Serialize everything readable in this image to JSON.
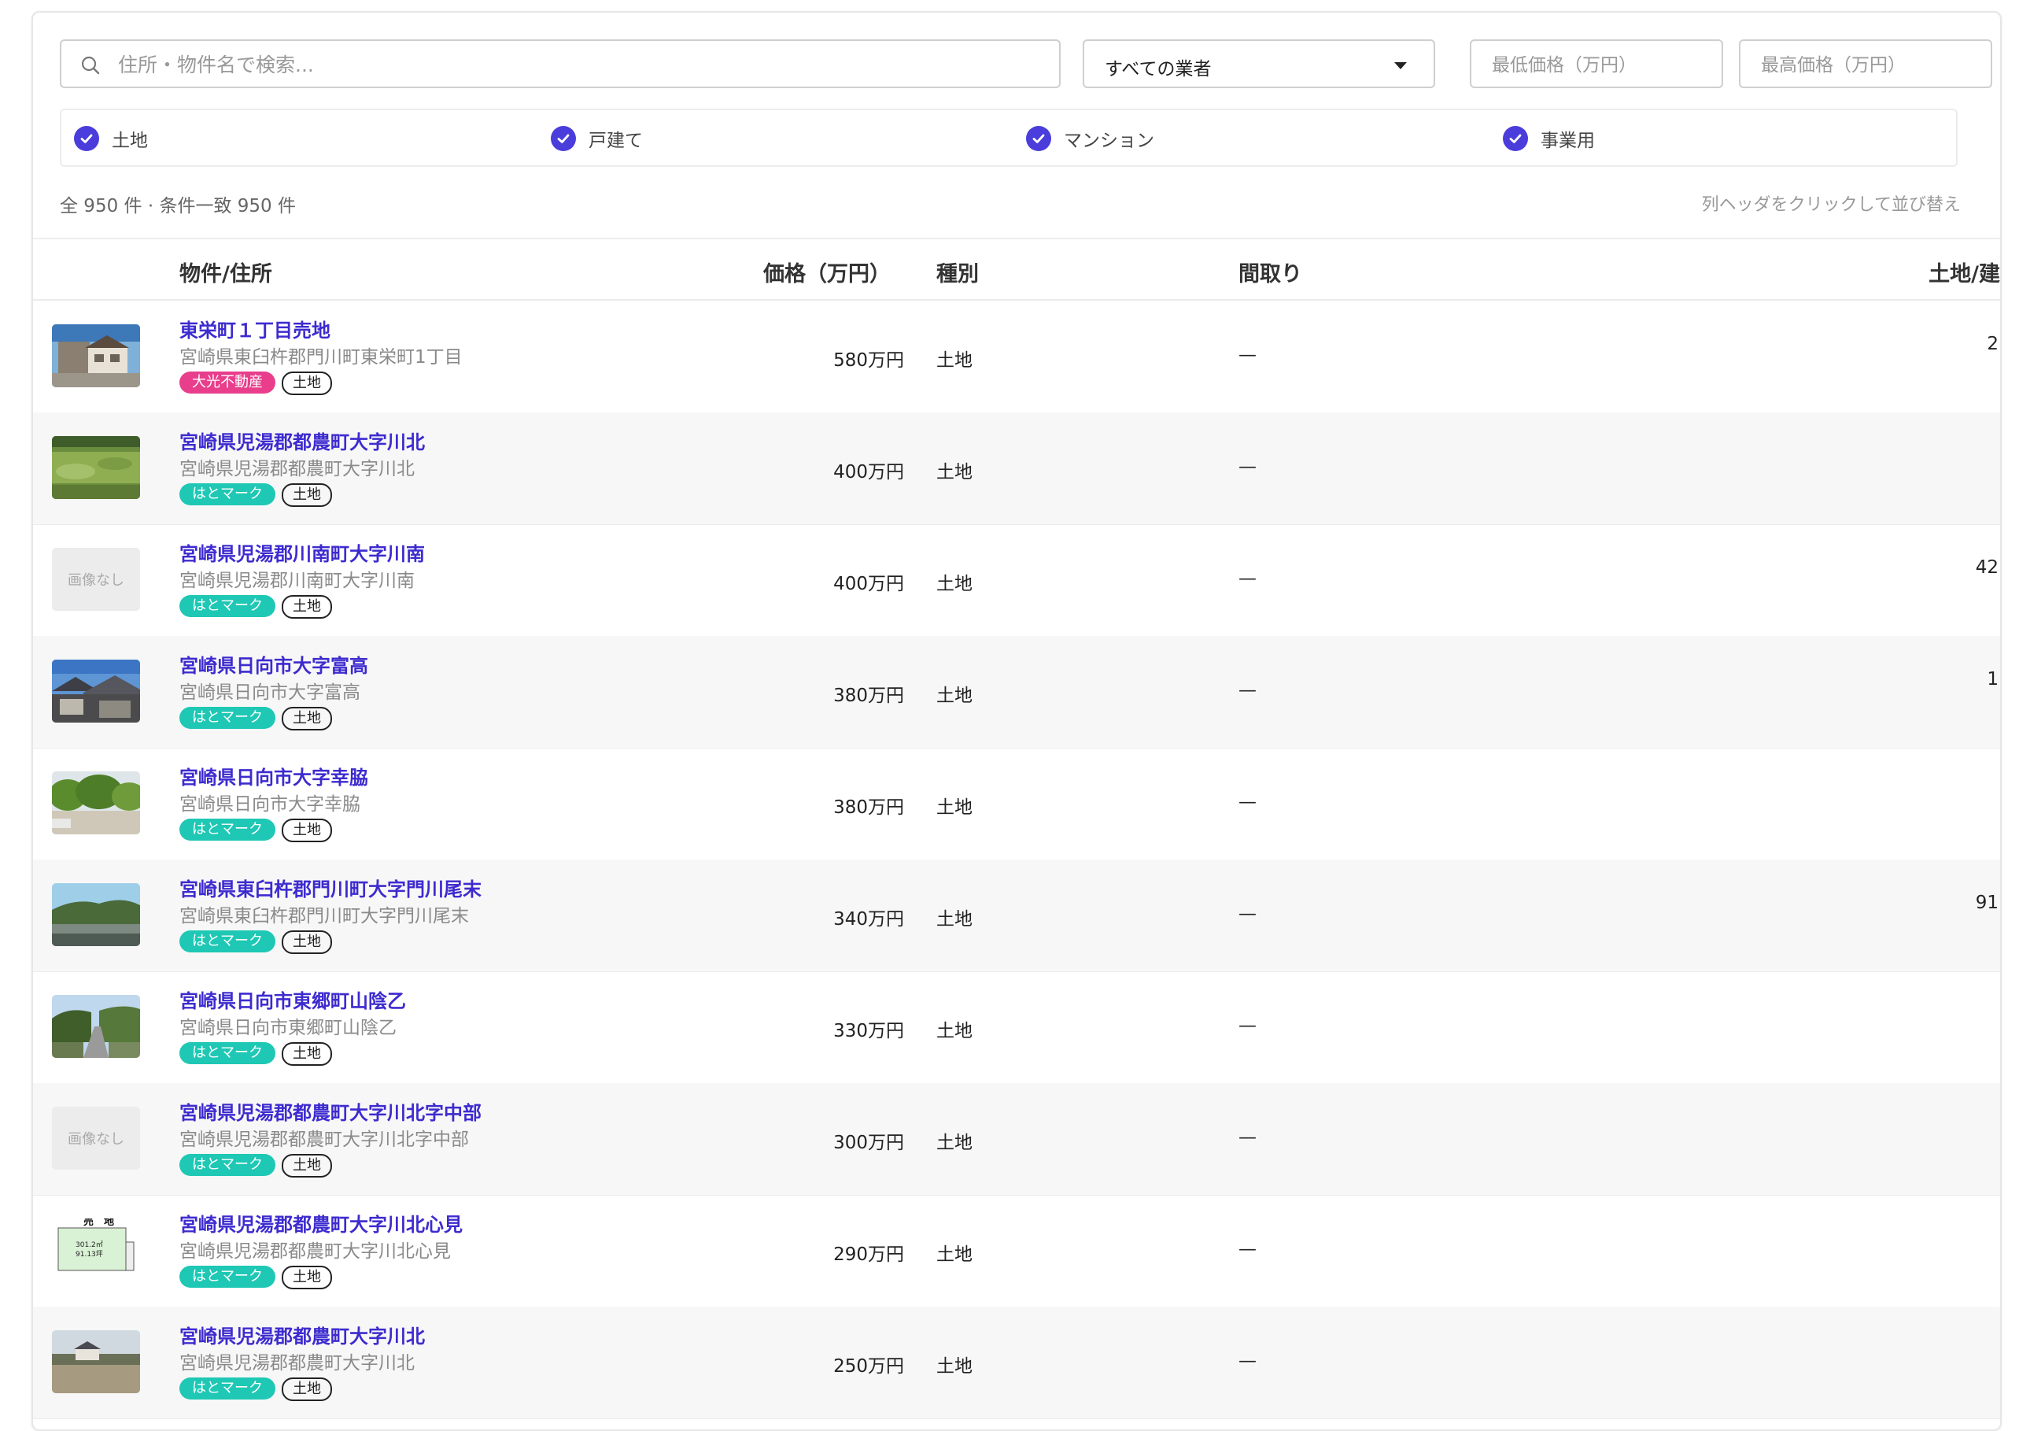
{
  "filters": {
    "search_placeholder": "住所・物件名で検索...",
    "agent_select": "すべての業者",
    "min_price_placeholder": "最低価格（万円）",
    "max_price_placeholder": "最高価格（万円）",
    "types": [
      {
        "label": "土地",
        "checked": true
      },
      {
        "label": "戸建て",
        "checked": true
      },
      {
        "label": "マンション",
        "checked": true
      },
      {
        "label": "事業用",
        "checked": true
      }
    ]
  },
  "summary": {
    "count_text": "全 950 件 · 条件一致 950 件",
    "sort_hint": "列ヘッダをクリックして並び替え"
  },
  "table": {
    "headers": {
      "property": "物件/住所",
      "price": "価格（万円）",
      "type": "種別",
      "layout": "間取り",
      "area": "土地/建"
    },
    "rows": [
      {
        "title": "東栄町１丁目売地",
        "address": "宮崎県東臼杵郡門川町東栄町1丁目",
        "agent": "大光不動産",
        "agent_color": "#e83e8c",
        "type_tag": "土地",
        "price": "580万円",
        "type": "土地",
        "layout": "—",
        "area": "2",
        "image": "house"
      },
      {
        "title": "宮崎県児湯郡都農町大字川北",
        "address": "宮崎県児湯郡都農町大字川北",
        "agent": "はとマーク",
        "agent_color": "#1ec8b4",
        "type_tag": "土地",
        "price": "400万円",
        "type": "土地",
        "layout": "—",
        "area": "",
        "image": "grass"
      },
      {
        "title": "宮崎県児湯郡川南町大字川南",
        "address": "宮崎県児湯郡川南町大字川南",
        "agent": "はとマーク",
        "agent_color": "#1ec8b4",
        "type_tag": "土地",
        "price": "400万円",
        "type": "土地",
        "layout": "—",
        "area": "42",
        "image": "none"
      },
      {
        "title": "宮崎県日向市大字富高",
        "address": "宮崎県日向市大字富高",
        "agent": "はとマーク",
        "agent_color": "#1ec8b4",
        "type_tag": "土地",
        "price": "380万円",
        "type": "土地",
        "layout": "—",
        "area": "1",
        "image": "roofs"
      },
      {
        "title": "宮崎県日向市大字幸脇",
        "address": "宮崎県日向市大字幸脇",
        "agent": "はとマーク",
        "agent_color": "#1ec8b4",
        "type_tag": "土地",
        "price": "380万円",
        "type": "土地",
        "layout": "—",
        "area": "",
        "image": "trees"
      },
      {
        "title": "宮崎県東臼杵郡門川町大字門川尾末",
        "address": "宮崎県東臼杵郡門川町大字門川尾末",
        "agent": "はとマーク",
        "agent_color": "#1ec8b4",
        "type_tag": "土地",
        "price": "340万円",
        "type": "土地",
        "layout": "—",
        "area": "91",
        "image": "hill"
      },
      {
        "title": "宮崎県日向市東郷町山陰乙",
        "address": "宮崎県日向市東郷町山陰乙",
        "agent": "はとマーク",
        "agent_color": "#1ec8b4",
        "type_tag": "土地",
        "price": "330万円",
        "type": "土地",
        "layout": "—",
        "area": "",
        "image": "road"
      },
      {
        "title": "宮崎県児湯郡都農町大字川北字中部",
        "address": "宮崎県児湯郡都農町大字川北字中部",
        "agent": "はとマーク",
        "agent_color": "#1ec8b4",
        "type_tag": "土地",
        "price": "300万円",
        "type": "土地",
        "layout": "—",
        "area": "",
        "image": "none"
      },
      {
        "title": "宮崎県児湯郡都農町大字川北心見",
        "address": "宮崎県児湯郡都農町大字川北心見",
        "agent": "はとマーク",
        "agent_color": "#1ec8b4",
        "type_tag": "土地",
        "price": "290万円",
        "type": "土地",
        "layout": "—",
        "area": "",
        "image": "plan"
      },
      {
        "title": "宮崎県児湯郡都農町大字川北",
        "address": "宮崎県児湯郡都農町大字川北",
        "agent": "はとマーク",
        "agent_color": "#1ec8b4",
        "type_tag": "土地",
        "price": "250万円",
        "type": "土地",
        "layout": "—",
        "area": "",
        "image": "field"
      }
    ],
    "no_image_label": "画像なし",
    "plan_text": [
      "売　地",
      "301.2㎡",
      "91.13坪"
    ]
  },
  "colors": {
    "accent": "#4a3ddb",
    "title_link": "#3d2bcf",
    "agent_hato": "#1ec8b4",
    "agent_taiko": "#e83e8c"
  }
}
